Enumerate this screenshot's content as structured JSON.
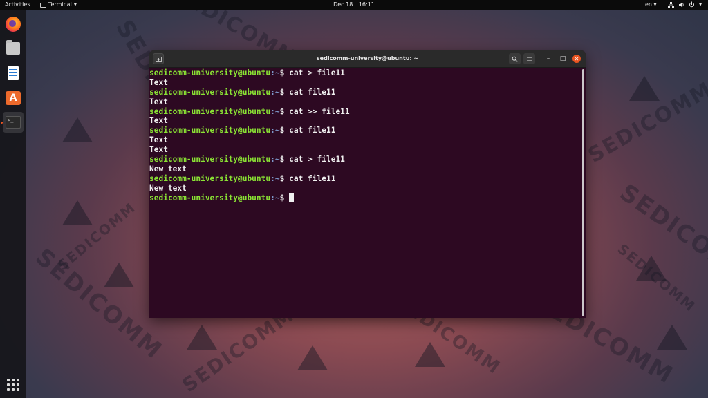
{
  "topbar": {
    "activities": "Activities",
    "app_menu": "Terminal",
    "app_menu_arrow": "▾",
    "date": "Dec 18",
    "time": "16:11",
    "language": "en",
    "language_arrow": "▾",
    "network_icon": "network-icon",
    "volume_icon": "volume-icon",
    "power_icon": "power-icon",
    "system_arrow": "▾"
  },
  "dock": {
    "items": [
      "firefox-icon",
      "files-icon",
      "writer-icon",
      "software-icon",
      "terminal-icon"
    ],
    "app_grid_icon": "app-grid-icon"
  },
  "wallpaper": {
    "watermark": "SEDICOMM"
  },
  "window": {
    "title": "sedicomm-university@ubuntu: ~",
    "new_tab_icon": "new-tab-icon",
    "search_icon": "search-icon",
    "menu_icon": "hamburger-menu-icon",
    "minimize": "–",
    "maximize": "□",
    "close": "✕"
  },
  "terminal": {
    "prompt_user": "sedicomm-university@ubuntu",
    "prompt_path": ":~",
    "prompt_symbol": "$ ",
    "lines": [
      {
        "type": "cmd",
        "text": "cat > file11"
      },
      {
        "type": "out",
        "text": "Text"
      },
      {
        "type": "cmd",
        "text": "cat file11"
      },
      {
        "type": "out",
        "text": "Text"
      },
      {
        "type": "cmd",
        "text": "cat >> file11"
      },
      {
        "type": "out",
        "text": "Text"
      },
      {
        "type": "cmd",
        "text": "cat file11"
      },
      {
        "type": "out",
        "text": "Text"
      },
      {
        "type": "out",
        "text": "Text"
      },
      {
        "type": "cmd",
        "text": "cat > file11"
      },
      {
        "type": "out",
        "text": "New text"
      },
      {
        "type": "cmd",
        "text": "cat file11"
      },
      {
        "type": "out",
        "text": "New text"
      },
      {
        "type": "prompt",
        "text": ""
      }
    ]
  },
  "colors": {
    "terminal_bg": "#2d0922",
    "prompt_user": "#8ae234",
    "prompt_path": "#7d97c9",
    "close_button": "#e95420"
  }
}
